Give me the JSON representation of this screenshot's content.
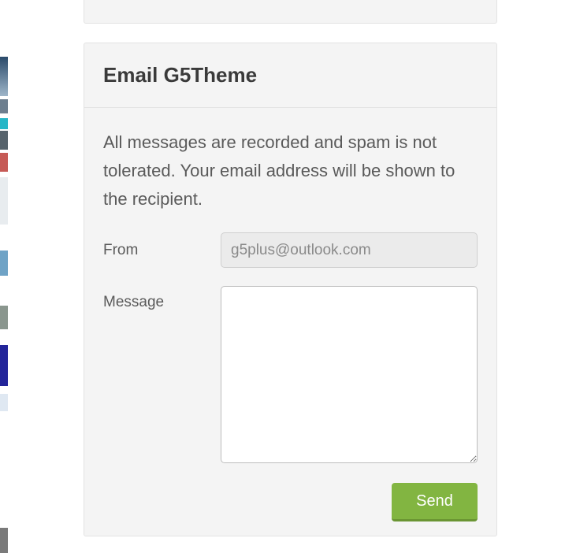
{
  "contact_form": {
    "title": "Email G5Theme",
    "notice": "All messages are recorded and spam is not tolerated. Your email address will be shown to the recipient.",
    "from_label": "From",
    "from_value": "g5plus@outlook.com",
    "message_label": "Message",
    "message_value": "",
    "send_label": "Send"
  },
  "colors": {
    "panel_bg": "#f4f4f4",
    "send_button": "#82b541",
    "title_text": "#3a3a3a"
  }
}
